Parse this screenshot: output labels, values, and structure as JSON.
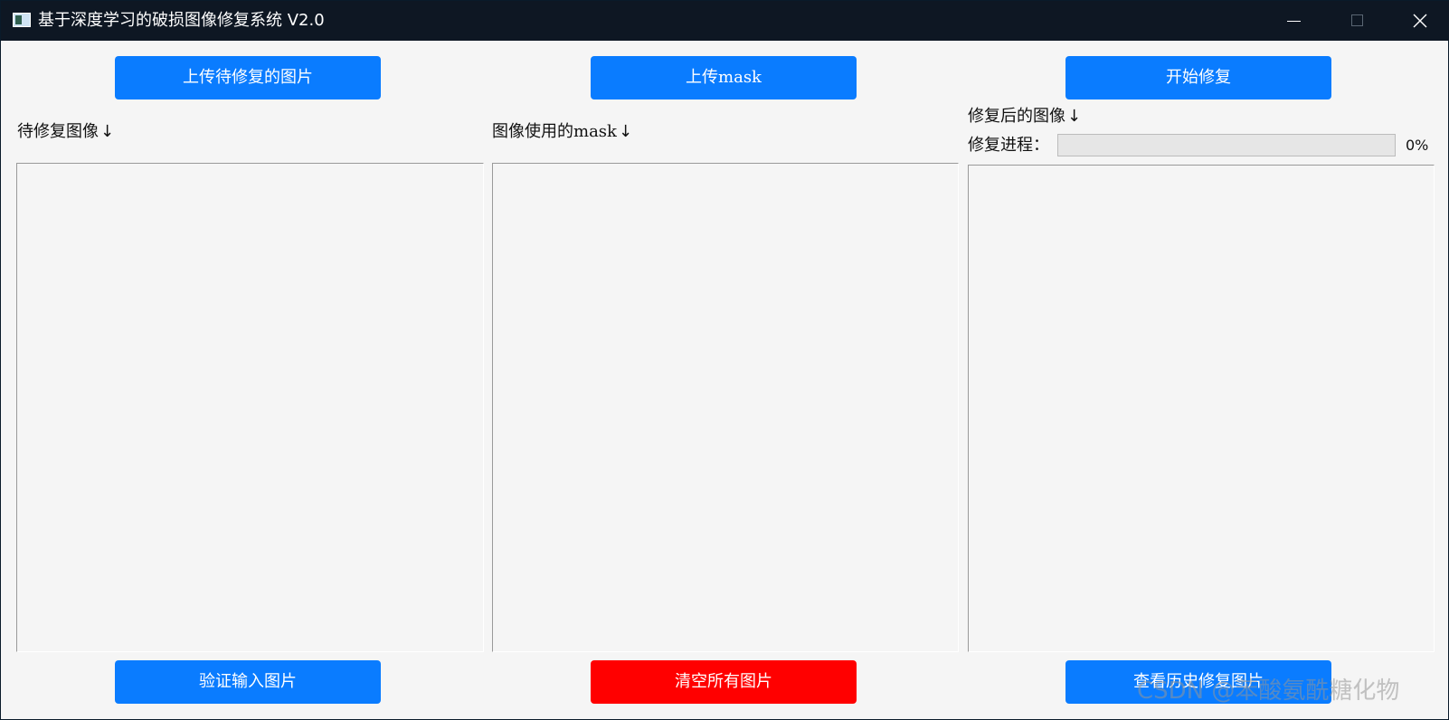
{
  "window": {
    "title": "基于深度学习的破损图像修复系统 V2.0"
  },
  "icons": {
    "app": "app-window-icon",
    "minimize": "minimize-icon",
    "maximize": "maximize-icon",
    "close": "close-icon"
  },
  "colors": {
    "titlebar": "#0e1723",
    "primary_button": "#0a7cff",
    "danger_button": "#ff0000",
    "background": "#f5f5f5"
  },
  "toolbar": {
    "upload_damaged_label": "上传待修复的图片",
    "upload_mask_label": "上传mask",
    "start_repair_label": "开始修复"
  },
  "panels": {
    "damaged_label": "待修复图像",
    "mask_label": "图像使用的mask",
    "result_label": "修复后的图像",
    "arrow": "↓"
  },
  "progress": {
    "label": "修复进程：",
    "percent": 0,
    "text": "0%"
  },
  "footer": {
    "verify_label": "验证输入图片",
    "clear_label": "清空所有图片",
    "history_label": "查看历史修复图片"
  },
  "watermark": "CSDN @苯酸氨酰糖化物"
}
